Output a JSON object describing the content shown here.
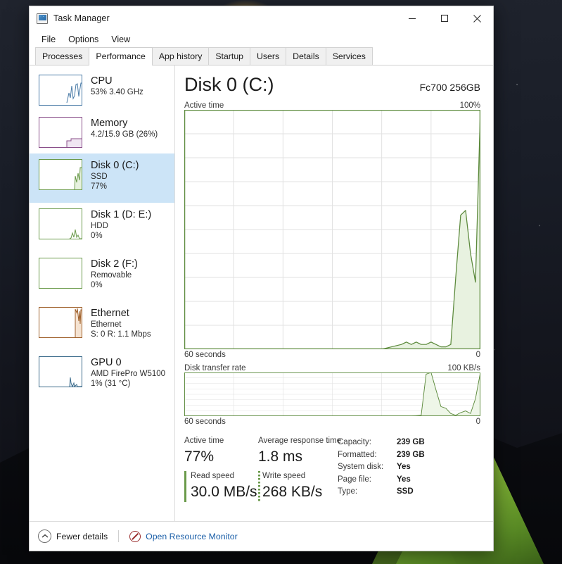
{
  "window": {
    "title": "Task Manager",
    "icon": "task-manager-icon",
    "controls": {
      "minimize": "minimize-icon",
      "maximize": "maximize-icon",
      "close": "close-icon"
    }
  },
  "menu": {
    "items": [
      "File",
      "Options",
      "View"
    ]
  },
  "tabs": {
    "items": [
      {
        "label": "Processes",
        "active": false
      },
      {
        "label": "Performance",
        "active": true
      },
      {
        "label": "App history",
        "active": false
      },
      {
        "label": "Startup",
        "active": false
      },
      {
        "label": "Users",
        "active": false
      },
      {
        "label": "Details",
        "active": false
      },
      {
        "label": "Services",
        "active": false
      }
    ]
  },
  "sidebar": {
    "items": [
      {
        "name": "CPU",
        "line2": "53%  3.40 GHz",
        "line3": "",
        "color": "#4a7ba7",
        "selected": false
      },
      {
        "name": "Memory",
        "line2": "4.2/15.9 GB (26%)",
        "line3": "",
        "color": "#8a4f8a",
        "selected": false
      },
      {
        "name": "Disk 0 (C:)",
        "line2": "SSD",
        "line3": "77%",
        "color": "#6a9a4a",
        "selected": true
      },
      {
        "name": "Disk 1 (D: E:)",
        "line2": "HDD",
        "line3": "0%",
        "color": "#6a9a4a",
        "selected": false
      },
      {
        "name": "Disk 2 (F:)",
        "line2": "Removable",
        "line3": "0%",
        "color": "#6a9a4a",
        "selected": false
      },
      {
        "name": "Ethernet",
        "line2": "Ethernet",
        "line3": "S: 0 R: 1.1 Mbps",
        "color": "#a0622d",
        "selected": false
      },
      {
        "name": "GPU 0",
        "line2": "AMD FirePro W5100",
        "line3": "1%  (31 °C)",
        "color": "#3a6a8a",
        "selected": false
      }
    ]
  },
  "main": {
    "title": "Disk 0 (C:)",
    "model": "Fc700 256GB",
    "accent": "#6a9a4a"
  },
  "chart_data": [
    {
      "type": "area",
      "title": "Active time",
      "ylabel": "Active time",
      "xlabel": "60 seconds",
      "y_max_label": "100%",
      "y_min_label": "0",
      "x_left_label": "60 seconds",
      "x_right_label": "0",
      "ylim": [
        0,
        100
      ],
      "xlim": [
        0,
        60
      ],
      "grid": true,
      "grid_cols": 6,
      "grid_rows": 10,
      "line_color": "#5c8a3c",
      "fill_color": "#e8f2e0",
      "x": [
        0,
        4,
        8,
        12,
        16,
        20,
        24,
        28,
        32,
        36,
        40,
        42,
        44,
        45,
        46,
        47,
        48,
        49,
        50,
        51,
        52,
        53,
        54,
        55,
        56,
        57,
        58,
        59,
        60
      ],
      "values": [
        0,
        0,
        0,
        0,
        0,
        0,
        0,
        0,
        0,
        0,
        0,
        1,
        2,
        3,
        2,
        3,
        2,
        2,
        3,
        2,
        1,
        1,
        2,
        30,
        56,
        58,
        40,
        28,
        100
      ]
    },
    {
      "type": "area",
      "title": "Disk transfer rate",
      "ylabel": "Disk transfer rate",
      "xlabel": "60 seconds",
      "y_max_label": "100 KB/s",
      "y_min_label": "0",
      "x_left_label": "60 seconds",
      "x_right_label": "0",
      "ylim": [
        0,
        100
      ],
      "xlim": [
        0,
        60
      ],
      "grid": true,
      "grid_cols": 6,
      "grid_rows": 8,
      "line_color": "#5c8a3c",
      "fill_color": "#eef6e8",
      "x": [
        0,
        10,
        20,
        30,
        40,
        46,
        48,
        49,
        50,
        51,
        52,
        53,
        54,
        55,
        56,
        57,
        58,
        59,
        60
      ],
      "values": [
        0,
        0,
        0,
        0,
        0,
        0,
        2,
        96,
        100,
        60,
        22,
        18,
        6,
        2,
        8,
        12,
        6,
        40,
        100
      ]
    }
  ],
  "stats": {
    "active_time_label": "Active time",
    "active_time_value": "77%",
    "avg_response_label": "Average response time",
    "avg_response_value": "1.8 ms",
    "read_speed_label": "Read speed",
    "read_speed_value": "30.0 MB/s",
    "write_speed_label": "Write speed",
    "write_speed_value": "268 KB/s",
    "specs": [
      {
        "key": "Capacity:",
        "value": "239 GB"
      },
      {
        "key": "Formatted:",
        "value": "239 GB"
      },
      {
        "key": "System disk:",
        "value": "Yes"
      },
      {
        "key": "Page file:",
        "value": "Yes"
      },
      {
        "key": "Type:",
        "value": "SSD"
      }
    ]
  },
  "footer": {
    "fewer_details": "Fewer details",
    "resource_monitor": "Open Resource Monitor",
    "link_color": "#1b5fa8"
  }
}
